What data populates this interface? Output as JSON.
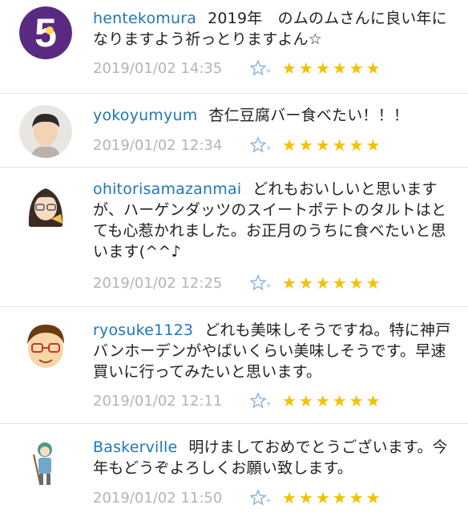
{
  "comments": [
    {
      "username": "hentekomura",
      "text": "2019年　のムのムさんに良い年になりますよう祈っとりますよん☆",
      "time": "2019/01/02 14:35",
      "rating": "★★★★★★"
    },
    {
      "username": "yokoyumyum",
      "text": "杏仁豆腐バー食べたい！！！",
      "time": "2019/01/02 12:34",
      "rating": "★★★★★★"
    },
    {
      "username": "ohitorisamazanmai",
      "text": "どれもおいしいと思いますが、ハーゲンダッツのスイートポテトのタルトはとても心惹かれました。お正月のうちに食べたいと思います(^^♪",
      "time": "2019/01/02 12:25",
      "rating": "★★★★★★"
    },
    {
      "username": "ryosuke1123",
      "text": "どれも美味しそうですね。特に神戸バンホーデンがやばいくらい美味しそうです。早速買いに行ってみたいと思います。",
      "time": "2019/01/02 12:11",
      "rating": "★★★★★★"
    },
    {
      "username": "Baskerville",
      "text": "明けましておめでとうございます。今年もどうぞよろしくお願い致します。",
      "time": "2019/01/02 11:50",
      "rating": "★★★★★★"
    }
  ],
  "colors": {
    "username": "#1f77b4",
    "star": "#f2c100",
    "add_star": "#8fb6e0",
    "timestamp": "#b4b4b4"
  }
}
